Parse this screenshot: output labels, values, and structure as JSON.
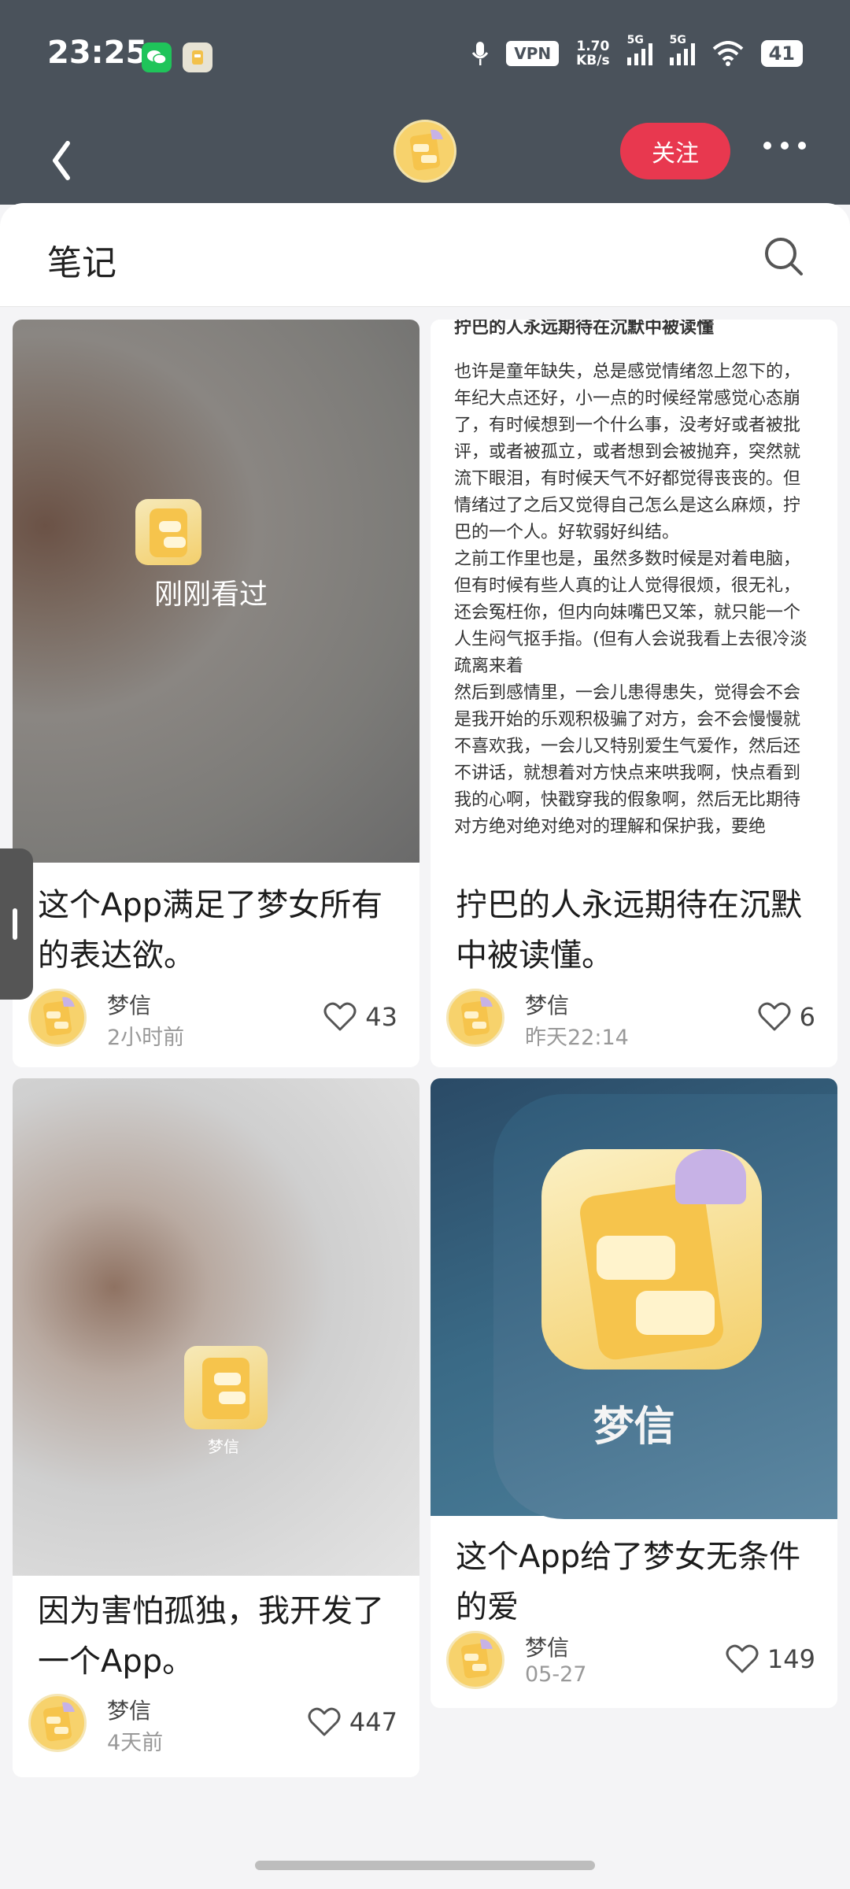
{
  "status_bar": {
    "time": "23:25",
    "vpn": "VPN",
    "speed_value": "1.70",
    "speed_unit": "KB/s",
    "signal1": "5G",
    "signal2": "5G",
    "battery": "41"
  },
  "header": {
    "follow_label": "关注"
  },
  "section": {
    "title": "笔记"
  },
  "cards": [
    {
      "overlay": "刚刚看过",
      "title": "这个App满足了梦女所有的表达欲。",
      "author": "梦信",
      "time": "2小时前",
      "likes": "43"
    },
    {
      "heading": "拧巴的人永远期待在沉默中被读懂",
      "body": [
        "也许是童年缺失，总是感觉情绪忽上忽下的，年纪大点还好，小一点的时候经常感觉心态崩了，有时候想到一个什么事，没考好或者被批评，或者被孤立，或者想到会被抛弃，突然就流下眼泪，有时候天气不好都觉得丧丧的。但情绪过了之后又觉得自己怎么是这么麻烦，拧巴的一个人。好软弱好纠结。",
        "之前工作里也是，虽然多数时候是对着电脑，但有时候有些人真的让人觉得很烦，很无礼，还会冤枉你，但内向妹嘴巴又笨，就只能一个人生闷气抠手指。(但有人会说我看上去很冷淡疏离来着",
        "然后到感情里，一会儿患得患失，觉得会不会是我开始的乐观积极骗了对方，会不会慢慢就不喜欢我，一会儿又特别爱生气爱作，然后还不讲话，就想着对方快点来哄我啊，快点看到我的心啊，快戳穿我的假象啊，然后无比期待对方绝对绝对绝对的理解和保护我，要绝"
      ],
      "title": "拧巴的人永远期待在沉默中被读懂。",
      "author": "梦信",
      "time": "昨天22:14",
      "likes": "6"
    },
    {
      "watermark": "梦信",
      "title": "因为害怕孤独，我开发了一个App。",
      "author": "梦信",
      "time": "4天前",
      "likes": "447"
    },
    {
      "app_name": "梦信",
      "title": "这个App给了梦女无条件的爱",
      "author": "梦信",
      "time": "05-27",
      "likes": "149"
    }
  ],
  "icons": {
    "back": "chevron-left-icon",
    "more": "more-dots-icon",
    "search": "search-icon",
    "like": "heart-outline-icon"
  },
  "colors": {
    "header_bg": "#4a525b",
    "follow_button": "#e8384f",
    "app_yellow": "#f6c44c"
  }
}
